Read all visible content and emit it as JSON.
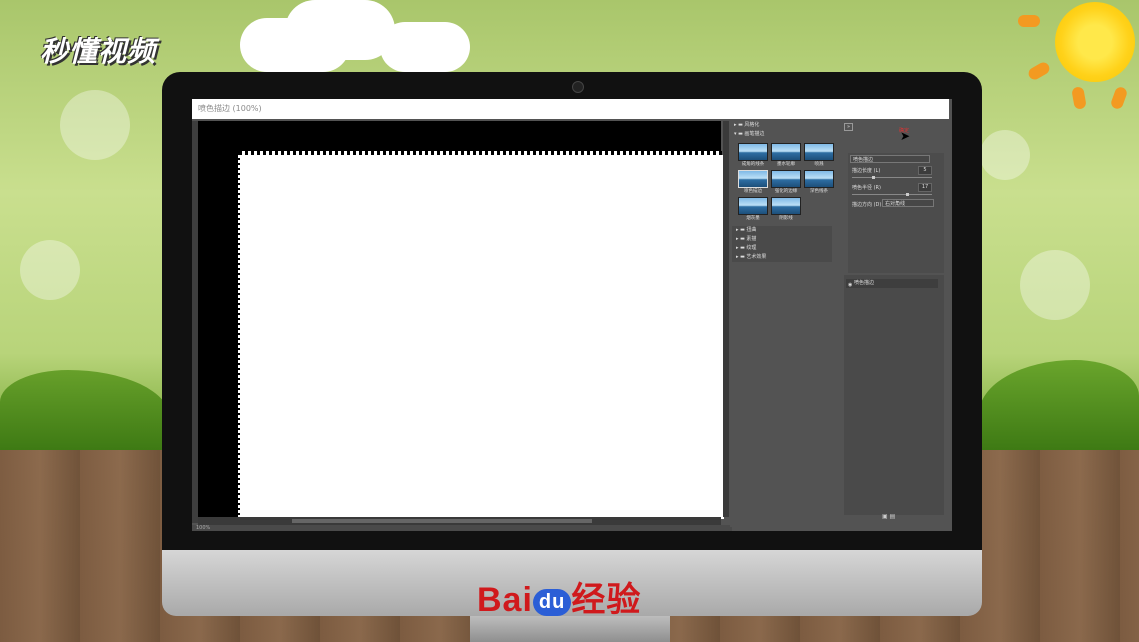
{
  "watermark": {
    "logo_text": "秒懂视频",
    "brand_left": "Bai",
    "brand_paw": "du",
    "brand_right": "经验"
  },
  "document": {
    "title": "喷色描边 (100%)"
  },
  "filter_gallery": {
    "groups": [
      {
        "label": "风格化",
        "expanded": false
      },
      {
        "label": "画笔描边",
        "expanded": true
      }
    ],
    "thumbnails": [
      {
        "label": "成角的线条",
        "icon": "filter-thumbnail"
      },
      {
        "label": "墨水轮廓",
        "icon": "filter-thumbnail"
      },
      {
        "label": "喷溅",
        "icon": "filter-thumbnail"
      },
      {
        "label": "喷色描边",
        "icon": "filter-thumbnail",
        "selected": true
      },
      {
        "label": "强化的边缘",
        "icon": "filter-thumbnail"
      },
      {
        "label": "深色线条",
        "icon": "filter-thumbnail"
      },
      {
        "label": "烟灰墨",
        "icon": "filter-thumbnail"
      },
      {
        "label": "阴影线",
        "icon": "filter-thumbnail"
      }
    ],
    "more_groups": [
      "扭曲",
      "素描",
      "纹理",
      "艺术效果"
    ]
  },
  "settings": {
    "toggle_label": "»",
    "ok_label": "确定",
    "filter_select": "喷色描边",
    "params": [
      {
        "label": "描边长度 (L)",
        "value": "5"
      },
      {
        "label": "喷色半径 (R)",
        "value": "17"
      }
    ],
    "direction_label": "描边方向 (D):",
    "direction_value": "右对角线",
    "layer_name": "喷色描边"
  },
  "status": {
    "zoom": "100%"
  }
}
